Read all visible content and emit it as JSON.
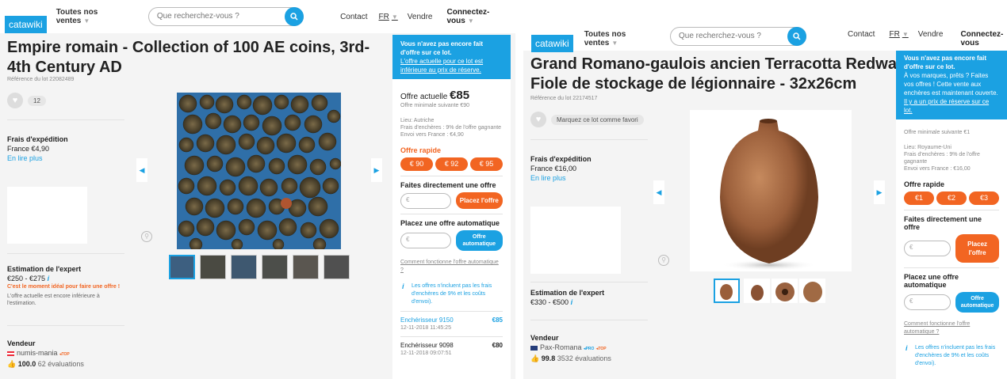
{
  "left": {
    "header": {
      "logo": "catawiki",
      "nav": "Toutes nos ventes",
      "search_placeholder": "Que recherchez-vous ?",
      "contact": "Contact",
      "lang": "FR",
      "sell": "Vendre",
      "login": "Connectez-vous"
    },
    "title_line1": "Empire romain - Collection of 100 AE coins, 3rd-",
    "title_line2": "4th Century AD",
    "ref": "Référence du lot 22082489",
    "favorites": "12",
    "shipping": {
      "label": "Frais d'expédition",
      "value": "France €4,90",
      "more": "En lire plus"
    },
    "estimate": {
      "label": "Estimation de l'expert",
      "value": "€250 - €275",
      "hint": "C'est le moment idéal pour faire une offre !",
      "note": "L'offre actuelle est encore inférieure à l'estimation."
    },
    "seller": {
      "label": "Vendeur",
      "name": "numis-mania",
      "badge": "TOP",
      "score": "100.0",
      "reviews": "62 évaluations"
    },
    "side": {
      "banner_title": "Vous n'avez pas encore fait d'offre sur ce lot.",
      "banner_link": "L'offre actuelle pour ce lot est inférieure au prix de réserve.",
      "current_label": "Offre actuelle",
      "current_value": "€85",
      "next": "Offre minimale suivante €90",
      "location": "Lieu: Autriche",
      "fees": "Frais d'enchères : 9% de l'offre gagnante",
      "ship": "Envoi vers France : €4,90",
      "quick_label": "Offre rapide",
      "quick": [
        "€ 90",
        "€ 92",
        "€ 95"
      ],
      "direct_label": "Faites directement une offre",
      "currency": "€",
      "place": "Placez l'offre",
      "auto_label": "Placez une offre automatique",
      "auto_btn": "Offre automatique",
      "how": "Comment fonctionne l'offre automatique ?",
      "info": "Les offres n'incluent pas les frais d'enchères de 9% et les coûts d'envoi).",
      "bids": [
        {
          "name": "Enchérisseur 9150",
          "date": "12-11-2018 11:45:25",
          "amount": "€85"
        },
        {
          "name": "Enchérisseur 9098",
          "date": "12-11-2018 09:07:51",
          "amount": "€80"
        }
      ]
    }
  },
  "right": {
    "header": {
      "logo": "catawiki",
      "nav": "Toutes nos ventes",
      "search_placeholder": "Que recherchez-vous ?",
      "contact": "Contact",
      "lang": "FR",
      "sell": "Vendre",
      "login": "Connectez-vous"
    },
    "title_line1": "Grand Romano-gaulois ancien Terracotta Redware",
    "title_line2": "Fiole de stockage de légionnaire - 32x26cm",
    "ref": "Référence du lot 22174517",
    "favorite_label": "Marquez ce lot comme favori",
    "shipping": {
      "label": "Frais d'expédition",
      "value": "France €16,00",
      "more": "En lire plus"
    },
    "estimate": {
      "label": "Estimation de l'expert",
      "value": "€330 - €500"
    },
    "seller": {
      "label": "Vendeur",
      "name": "Pax-Romana",
      "badge1": "PRO",
      "badge2": "TOP",
      "score": "99.8",
      "reviews": "3532 évaluations"
    },
    "side": {
      "banner_title": "Vous n'avez pas encore fait d'offre sur ce lot.",
      "banner_text": "À vos marques, prêts ? Faites vos offres ! Cette vente aux enchères est maintenant ouverte.",
      "banner_link": "Il y a un prix de réserve sur ce lot.",
      "next": "Offre minimale suivante €1",
      "location": "Lieu: Royaume-Uni",
      "fees": "Frais d'enchères : 9% de l'offre gagnante",
      "ship": "Envoi vers France : €16,00",
      "quick_label": "Offre rapide",
      "quick": [
        "€1",
        "€2",
        "€3"
      ],
      "direct_label": "Faites directement une offre",
      "currency": "€",
      "place": "Placez l'offre",
      "auto_label": "Placez une offre automatique",
      "auto_btn": "Offre automatique",
      "how": "Comment fonctionne l'offre automatique ?",
      "info": "Les offres n'incluent pas les frais d'enchères de 9% et les coûts d'envoi)."
    }
  },
  "colors": {
    "accent": "#1ba1e2",
    "orange": "#f26522",
    "green": "#8bc34a"
  }
}
